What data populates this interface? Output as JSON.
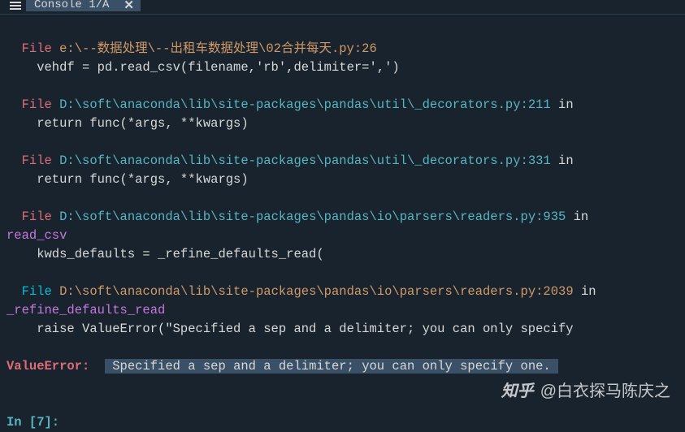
{
  "tab": {
    "label": "Console 1/A",
    "close": "✕"
  },
  "traceback": {
    "l1_file": "  File ",
    "l1_path": "e:\\--数据处理\\--出租车数据处理\\02合并每天.py:26",
    "l1_code": "    vehdf = pd.read_csv(filename,'rb',delimiter=',')",
    "l2_file": "  File ",
    "l2_path": "D:\\soft\\anaconda\\lib\\site-packages\\pandas\\util\\_decorators.py:211",
    "l2_in": " in ",
    "l2_code": "    return func(*args, **kwargs)",
    "l3_file": "  File ",
    "l3_path": "D:\\soft\\anaconda\\lib\\site-packages\\pandas\\util\\_decorators.py:331",
    "l3_in": " in ",
    "l3_code": "    return func(*args, **kwargs)",
    "l4_file": "  File ",
    "l4_path": "D:\\soft\\anaconda\\lib\\site-packages\\pandas\\io\\parsers\\readers.py:935",
    "l4_in": " in",
    "l4_func": "read_csv",
    "l4_code": "    kwds_defaults = _refine_defaults_read(",
    "l5_file": "  File ",
    "l5_path": "D:\\soft\\anaconda\\lib\\site-packages\\pandas\\io\\parsers\\readers.py:2039",
    "l5_in": " in",
    "l5_func": "_refine_defaults_read",
    "l5_code": "    raise ValueError(\"Specified a sep and a delimiter; you can only specify ",
    "err_label": "ValueError: ",
    "err_msg": " Specified a sep and a delimiter; you can only specify one. ",
    "prompt": "In [7]:"
  },
  "watermark": {
    "logo": "知乎",
    "text": "@白衣探马陈庆之"
  }
}
